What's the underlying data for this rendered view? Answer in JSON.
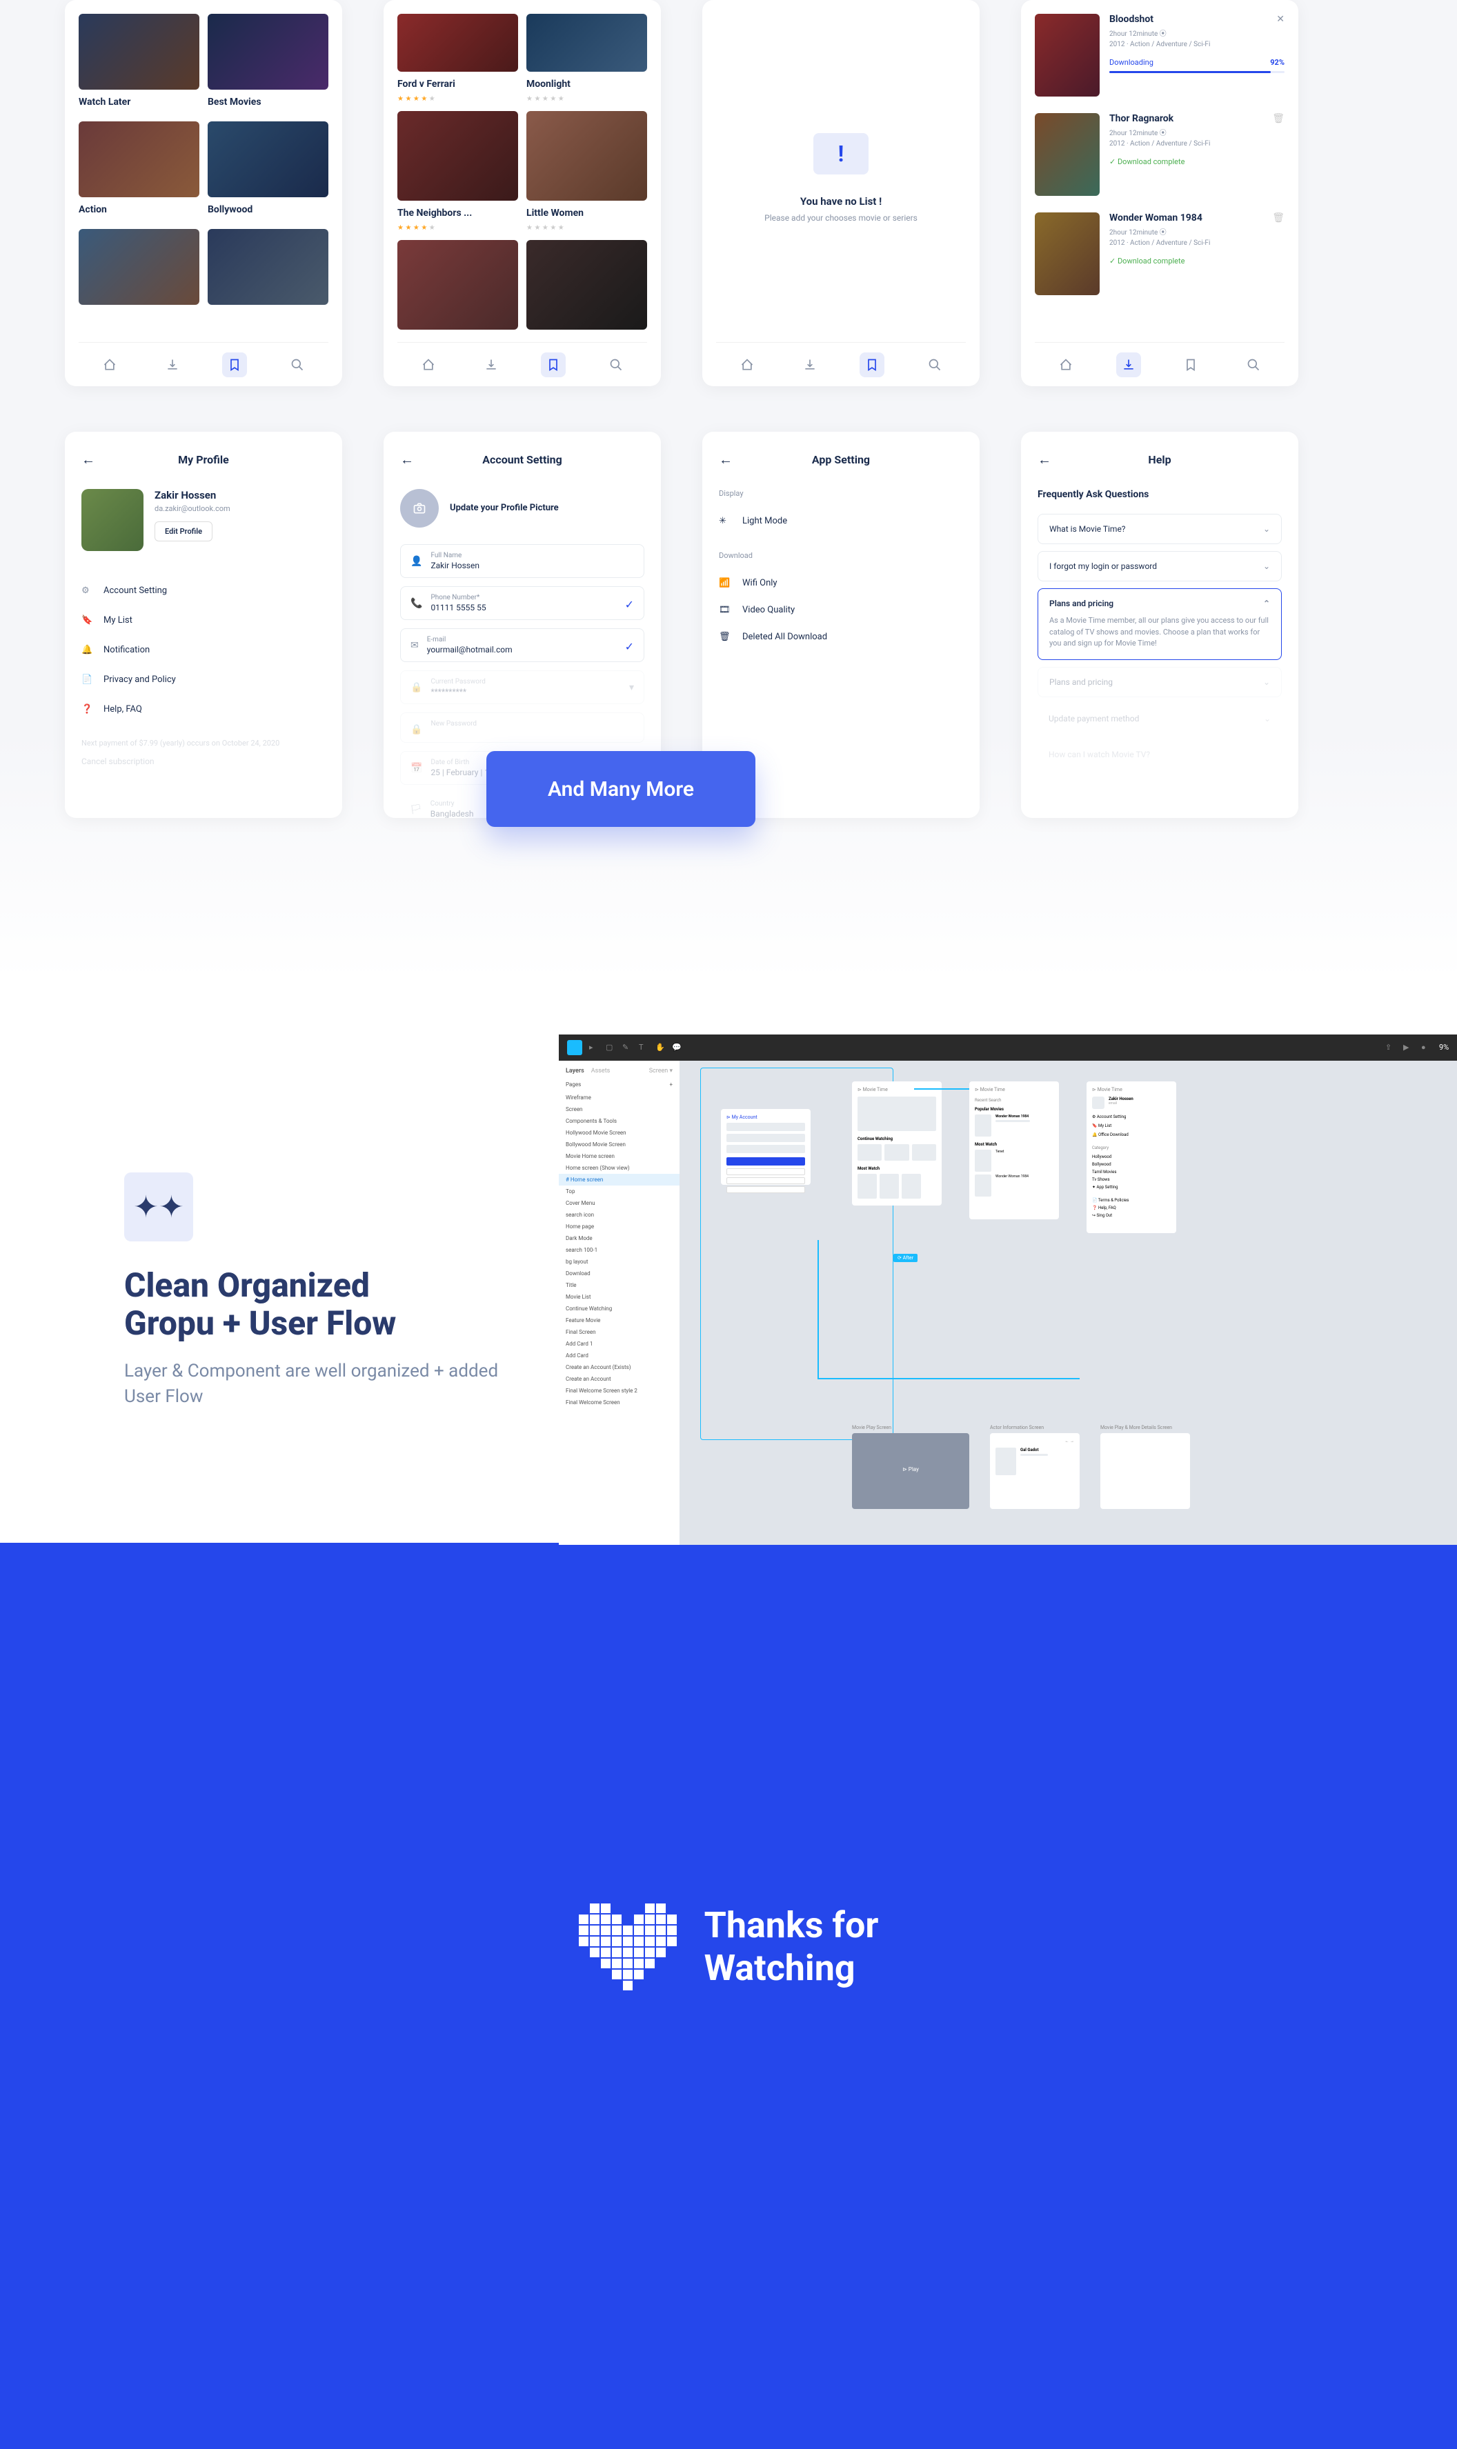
{
  "screen1": {
    "cat1": "Watch Later",
    "cat2": "Best Movies",
    "cat3": "Action",
    "cat4": "Bollywood"
  },
  "screen2": {
    "m1": "Ford v Ferrari",
    "m2": "Moonlight",
    "m3": "The Neighbors ...",
    "m4": "Little Women"
  },
  "screen3": {
    "title": "You have no List !",
    "sub": "Please add your chooses movie or seriers"
  },
  "screen4": {
    "items": [
      {
        "title": "Bloodshot",
        "dur": "2hour 12minute",
        "meta": "2012 · Action / Adventure / Sci-Fi",
        "status": "Downloading",
        "pct": "92%",
        "done": false
      },
      {
        "title": "Thor Ragnarok",
        "dur": "2hour 12minute",
        "meta": "2012 · Action / Adventure / Sci-Fi",
        "status": "Download complete",
        "done": true
      },
      {
        "title": "Wonder Woman 1984",
        "dur": "2hour 12minute",
        "meta": "2012 · Action / Adventure / Sci-Fi",
        "status": "Download complete",
        "done": true
      }
    ]
  },
  "profile": {
    "header": "My Profile",
    "name": "Zakir Hossen",
    "email": "da.zakir@outlook.com",
    "edit": "Edit Profile",
    "menu": [
      "Account Setting",
      "My List",
      "Notification",
      "Privacy and Policy",
      "Help, FAQ"
    ],
    "note": "Next payment of $7.99 (yearly) occurs on October 24, 2020",
    "cancel": "Cancel subscription"
  },
  "account": {
    "header": "Account Setting",
    "upload": "Update your Profile Picture",
    "fields": [
      {
        "label": "Full Name",
        "val": "Zakir Hossen"
      },
      {
        "label": "Phone Number*",
        "val": "01111 5555 55",
        "ok": true
      },
      {
        "label": "E-mail",
        "val": "yourmail@hotmail.com",
        "ok": true
      },
      {
        "label": "Current Password",
        "val": "**********"
      },
      {
        "label": "New Password",
        "val": ""
      },
      {
        "label": "Date of Birth",
        "val": "25 | February | 1995"
      },
      {
        "label": "Country",
        "val": "Bangladesh"
      }
    ]
  },
  "appsetting": {
    "header": "App Setting",
    "display": "Display",
    "light": "Light Mode",
    "download": "Download",
    "wifi": "Wifi Only",
    "quality": "Video Quality",
    "delete": "Deleted All Download"
  },
  "help": {
    "header": "Help",
    "faq": "Frequently Ask Questions",
    "items": [
      {
        "q": "What is Movie Time?"
      },
      {
        "q": "I forgot my login or password"
      },
      {
        "q": "Plans and pricing",
        "open": true,
        "a": "As a Movie Time member, all our plans give you access to our full catalog of TV shows and movies. Choose a plan that works for you and sign up for Movie Time!"
      },
      {
        "q": "Plans and pricing"
      },
      {
        "q": "Update payment method"
      },
      {
        "q": "How can I watch Movie TV?"
      }
    ]
  },
  "manymore": "And Many More",
  "org": {
    "title1": "Clean Organized",
    "title2": "Gropu + User Flow",
    "sub": "Layer & Component are well organized + added User Flow"
  },
  "figma": {
    "tabs": [
      "Layers",
      "Assets"
    ],
    "pages": "Pages",
    "list": [
      "Wireframe",
      "Screen",
      "Components & Tools",
      "Hollywood Movie Screen",
      "Bollywood Movie Screen",
      "Movie Home screen",
      "Home screen (Show view)",
      "Home screen",
      "Top",
      "Cover Menu",
      "search icon",
      "Home page",
      "Dark Mode",
      "search 100-1",
      "bg layout",
      "Download",
      "Title",
      "Movie List",
      "Continue Watching",
      "Feature Movie",
      "Final Screen",
      "Add Card 1",
      "Add Card",
      "Create an Account (Exists)",
      "Create an Account",
      "Final Welcome Screen style 2",
      "Final Welcome Screen"
    ],
    "selected": "Home screen"
  },
  "thanks": {
    "l1": "Thanks for",
    "l2": "Watching"
  }
}
